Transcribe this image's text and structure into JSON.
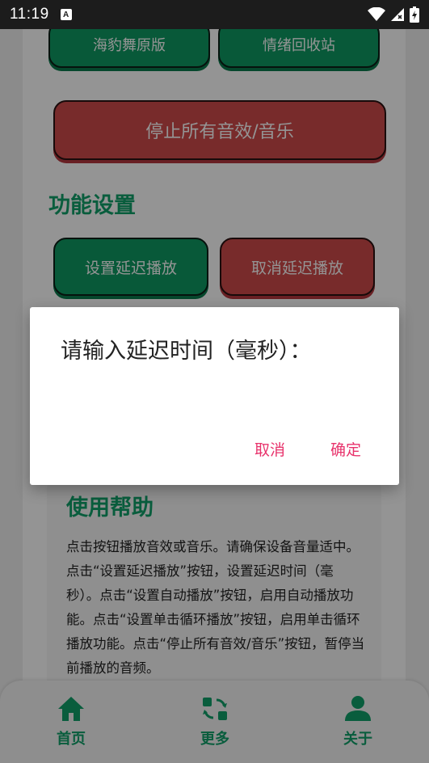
{
  "status_bar": {
    "time": "11:19",
    "notification_letter": "A"
  },
  "buttons": {
    "seal_dance": "海豹舞原版",
    "emotion_recycle": "情绪回收站",
    "stop_all": "停止所有音效/音乐",
    "set_delay": "设置延迟播放",
    "cancel_delay": "取消延迟播放"
  },
  "sections": {
    "function_settings": "功能设置"
  },
  "help": {
    "title": "使用帮助",
    "text": "点击按钮播放音效或音乐。请确保设备音量适中。点击“设置延迟播放”按钮，设置延迟时间（毫秒）。点击“设置自动播放”按钮，启用自动播放功能。点击“设置单击循环播放”按钮，启用单击循环播放功能。点击“停止所有音效/音乐”按钮，暂停当前播放的音频。"
  },
  "nav": {
    "home": "首页",
    "more": "更多",
    "about": "关于"
  },
  "dialog": {
    "title": "请输入延迟时间（毫秒）：",
    "input_value": "",
    "cancel": "取消",
    "confirm": "确定"
  },
  "colors": {
    "accent_green": "#10a06a",
    "accent_red": "#cf4a4a",
    "dialog_action": "#e8336c"
  }
}
